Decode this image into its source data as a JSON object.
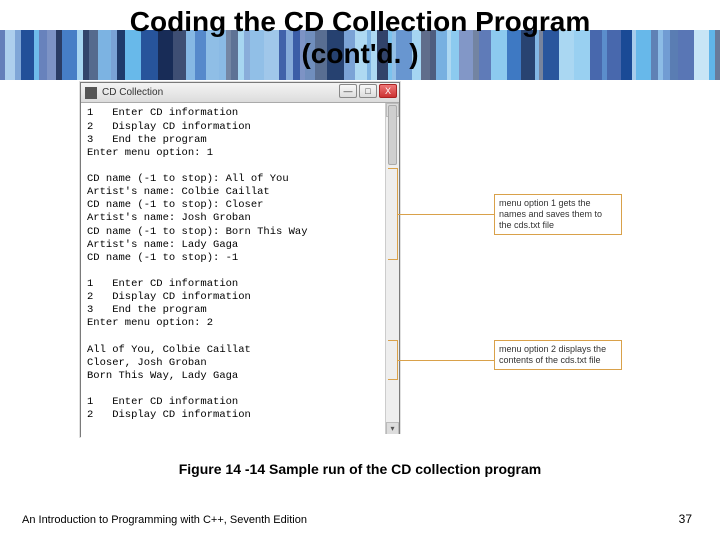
{
  "title_line1": "Coding the CD Collection Program",
  "title_line2": "(cont'd. )",
  "window": {
    "title": "CD Collection",
    "min": "—",
    "max": "□",
    "close": "X"
  },
  "console": {
    "block1": "1   Enter CD information\n2   Display CD information\n3   End the program\nEnter menu option: 1",
    "block2": "CD name (-1 to stop): All of You\nArtist's name: Colbie Caillat\nCD name (-1 to stop): Closer\nArtist's name: Josh Groban\nCD name (-1 to stop): Born This Way\nArtist's name: Lady Gaga\nCD name (-1 to stop): -1",
    "block3": "1   Enter CD information\n2   Display CD information\n3   End the program\nEnter menu option: 2",
    "block4": "All of You, Colbie Caillat\nCloser, Josh Groban\nBorn This Way, Lady Gaga",
    "block5": "1   Enter CD information\n2   Display CD information"
  },
  "callouts": {
    "c1": "menu option 1 gets the names and saves them to the cds.txt file",
    "c2": "menu option 2 displays the contents of the cds.txt file"
  },
  "caption": "Figure 14 -14 Sample run of the CD collection program",
  "footer_left": "An Introduction to Programming with C++, Seventh Edition",
  "page_number": "37",
  "stripe_colors": [
    "#2a4fa0",
    "#5bb3e8",
    "#08275c",
    "#9fd2f0",
    "#0c3f8f",
    "#3a76c2",
    "#0a1f4d",
    "#6aa8de"
  ]
}
